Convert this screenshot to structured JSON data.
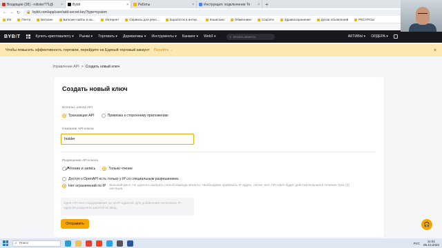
{
  "browser": {
    "tabs": [
      {
        "label": "Входящие (28) - rotister??1@",
        "color": "#d93025",
        "active": false
      },
      {
        "label": "Bybit",
        "color": "#111111",
        "active": true
      },
      {
        "label": "Работы",
        "color": "#f4b400",
        "active": false
      },
      {
        "label": "Инструкция: подключение To",
        "color": "#4285f4",
        "active": false
      }
    ],
    "new_tab": "+",
    "close": "×",
    "back": "←",
    "forward": "→",
    "reload": "↻",
    "url": "bybit.com/app/user/add-secret-key?type=system",
    "bookmarks": [
      "EN",
      "Почта",
      "Биткоин",
      "Биткоин-сайты и на...",
      "Интернет",
      "Сервисы для рекл...",
      "Заработок в интер...",
      "Кошельки",
      "Обменники",
      "Соцсети",
      "Здравоохранение",
      "Доски объявлений",
      "РЕСУРСЫ"
    ]
  },
  "header": {
    "logo_main": "BYB",
    "logo_accent": "I",
    "logo_end": "T",
    "nav": [
      "Купить криптовалюту ▾",
      "Рынки ▾",
      "Торговать ▾",
      "Деривативы ▾",
      "Инструменты ▾",
      "Банкинг ▾",
      "Web3 ▾"
    ],
    "search_placeholder": "Искать монеты",
    "assets": "АКТИВЫ ▾",
    "orders": "ОРДЕРА ▾"
  },
  "banner": {
    "text": "Чтобы повысить эффективность торговли, перейдите на Единый торговый аккаунт",
    "link": "Перейти →",
    "close": "×"
  },
  "breadcrumb": {
    "parent": "Управление API",
    "separator": ">",
    "current": "Создать новый ключ"
  },
  "form": {
    "title": "Создать новый ключ",
    "usage_label": "Использ. ключа API",
    "usage_options": [
      "Транзакция API",
      "Привязка к стороннему приложению"
    ],
    "name_label": "Название API-ключа",
    "name_value": "Insider",
    "perm_label": "Разрешения API-ключа",
    "perm_options": [
      "Чтение и запись",
      "Только чтение"
    ],
    "ip_options": [
      "Доступ к OpenAPI есть только у IP со специальным разрешением.",
      "Нет ограничений по IP"
    ],
    "ip_warning": "Высокий риск. Не удалось выбрать способ вывода монеты. Необходимо привязать IP адрес, после чего API ключ будет действительным в течение трех (3) месяцев.",
    "ip_placeholder": "Один API-ключ поддерживает до 30 IP-адресов. Для добавления нескольких IP-адресов разделите запятой их ввод.",
    "submit": "Отправить"
  },
  "taskbar": {
    "search": "Поиск",
    "lang": "РУС",
    "time": "11:51",
    "date": "05.10.2023"
  },
  "colors": {
    "accent": "#f7a600",
    "header_bg": "#17181e",
    "banner_bg": "#fde7b3"
  }
}
